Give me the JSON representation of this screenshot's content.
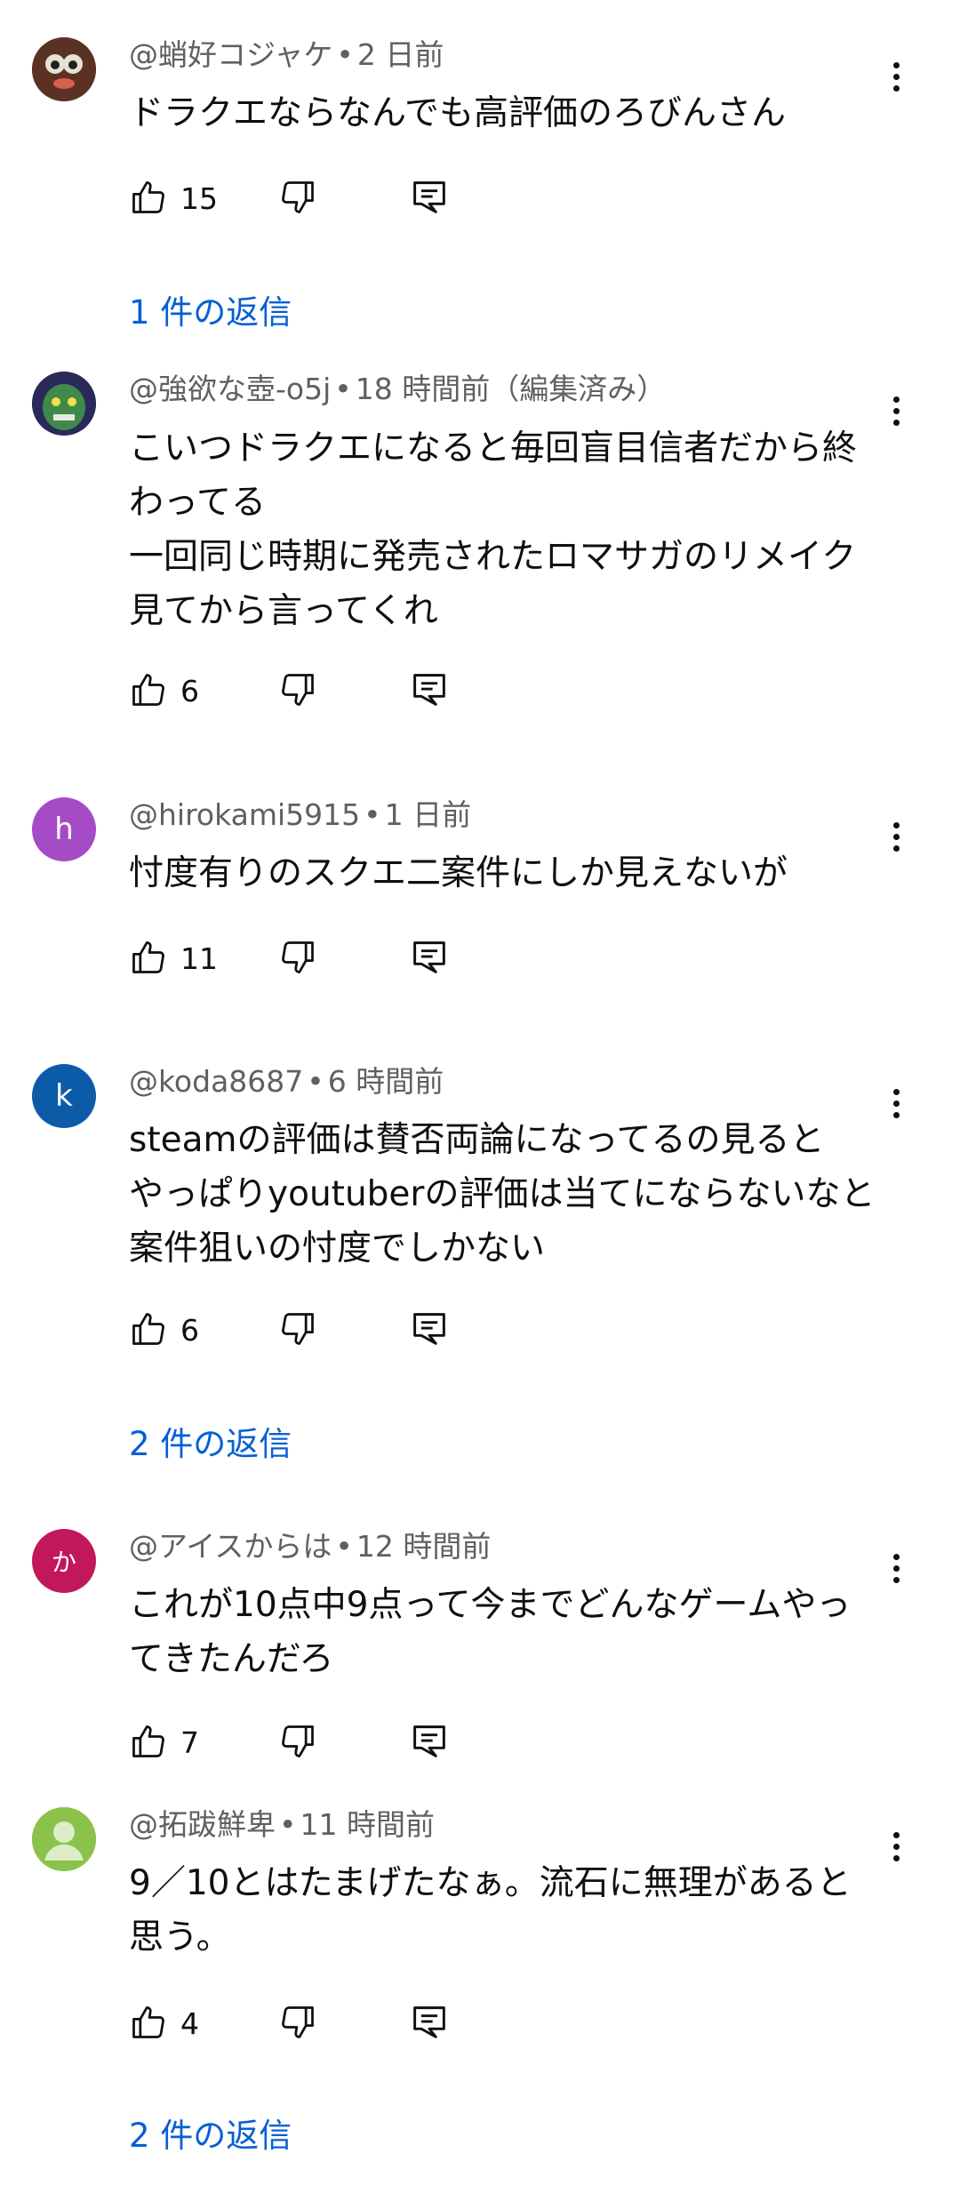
{
  "colors": {
    "link": "#065fd4",
    "meta": "#606060",
    "text": "#0f0f0f"
  },
  "icons": {
    "like": "thumb-up-icon",
    "dislike": "thumb-down-icon",
    "reply": "reply-icon",
    "more": "more-vert-icon"
  },
  "comments": [
    {
      "author": "@蛸好コジャケ",
      "time": "2 日前",
      "edited": "",
      "text": "ドラクエならなんでも高評価のろびんさん",
      "likes": "15",
      "replies": "1 件の返信",
      "avatar_letter": "",
      "avatar_color": "#6b3a2a"
    },
    {
      "author": "@強欲な壺-o5j",
      "time": "18 時間前",
      "edited": "（編集済み）",
      "text": "こいつドラクエになると毎回盲目信者だから終\nわってる\n一回同じ時期に発売されたロマサガのリメイク\n見てから言ってくれ",
      "likes": "6",
      "replies": "",
      "avatar_letter": "",
      "avatar_color": "#1f4d2e"
    },
    {
      "author": "@hirokami5915",
      "time": "1 日前",
      "edited": "",
      "text": "忖度有りのスクエ二案件にしか見えないが",
      "likes": "11",
      "replies": "",
      "avatar_letter": "h",
      "avatar_color": "#a54bc6"
    },
    {
      "author": "@koda8687",
      "time": "6 時間前",
      "edited": "",
      "text": "steamの評価は賛否両論になってるの見ると\nやっぱりyoutuberの評価は当てにならないなと\n案件狙いの忖度でしかない",
      "likes": "6",
      "replies": "2 件の返信",
      "avatar_letter": "k",
      "avatar_color": "#0b5ba8"
    },
    {
      "author": "@アイスからは",
      "time": "12 時間前",
      "edited": "",
      "text": "これが10点中9点って今までどんなゲームやっ\nてきたんだろ",
      "likes": "7",
      "replies": "",
      "avatar_letter": "か",
      "avatar_color": "#c2185b"
    },
    {
      "author": "@拓跋鮮卑",
      "time": "11 時間前",
      "edited": "",
      "text": "9／10とはたまげたなぁ。流石に無理があると\n思う。",
      "likes": "4",
      "replies": "2 件の返信",
      "avatar_letter": "",
      "avatar_color": "#8bc34a"
    }
  ]
}
